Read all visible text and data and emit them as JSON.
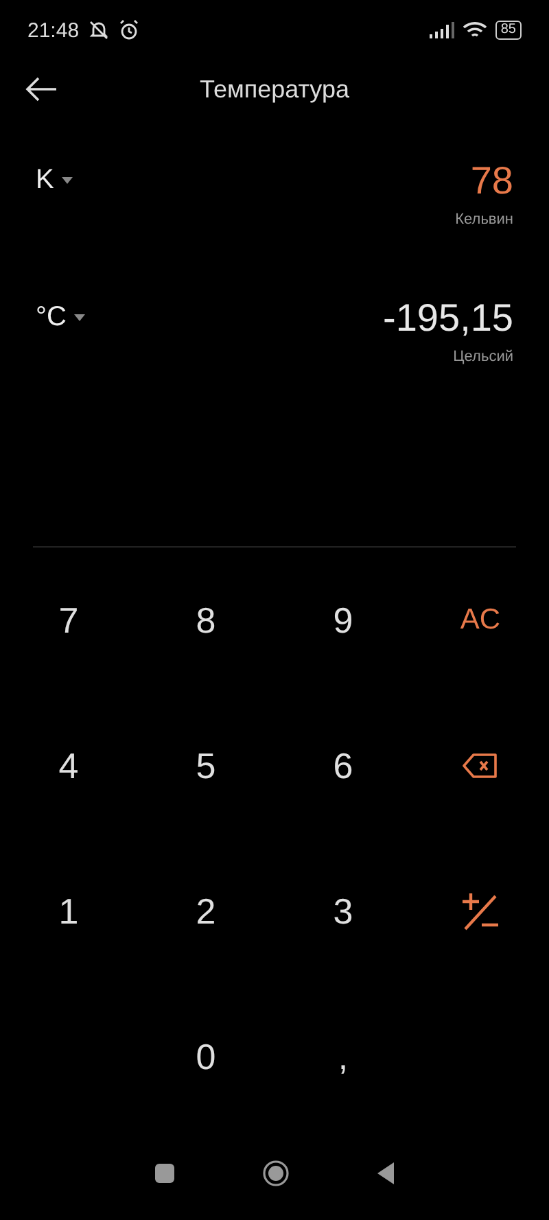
{
  "status_bar": {
    "time": "21:48",
    "battery": "85"
  },
  "header": {
    "title": "Температура"
  },
  "units": [
    {
      "unit": "K",
      "value": "78",
      "name": "Кельвин",
      "selected": true
    },
    {
      "unit": "°C",
      "value": "-195,15",
      "name": "Цельсий",
      "selected": false
    }
  ],
  "keypad": [
    {
      "kind": "digit",
      "label": "7"
    },
    {
      "kind": "digit",
      "label": "8"
    },
    {
      "kind": "digit",
      "label": "9"
    },
    {
      "kind": "clear",
      "label": "AC"
    },
    {
      "kind": "digit",
      "label": "4"
    },
    {
      "kind": "digit",
      "label": "5"
    },
    {
      "kind": "digit",
      "label": "6"
    },
    {
      "kind": "backspace"
    },
    {
      "kind": "digit",
      "label": "1"
    },
    {
      "kind": "digit",
      "label": "2"
    },
    {
      "kind": "digit",
      "label": "3"
    },
    {
      "kind": "sign"
    },
    {
      "kind": "blank"
    },
    {
      "kind": "digit",
      "label": "0"
    },
    {
      "kind": "digit",
      "label": ","
    },
    {
      "kind": "blank"
    }
  ]
}
